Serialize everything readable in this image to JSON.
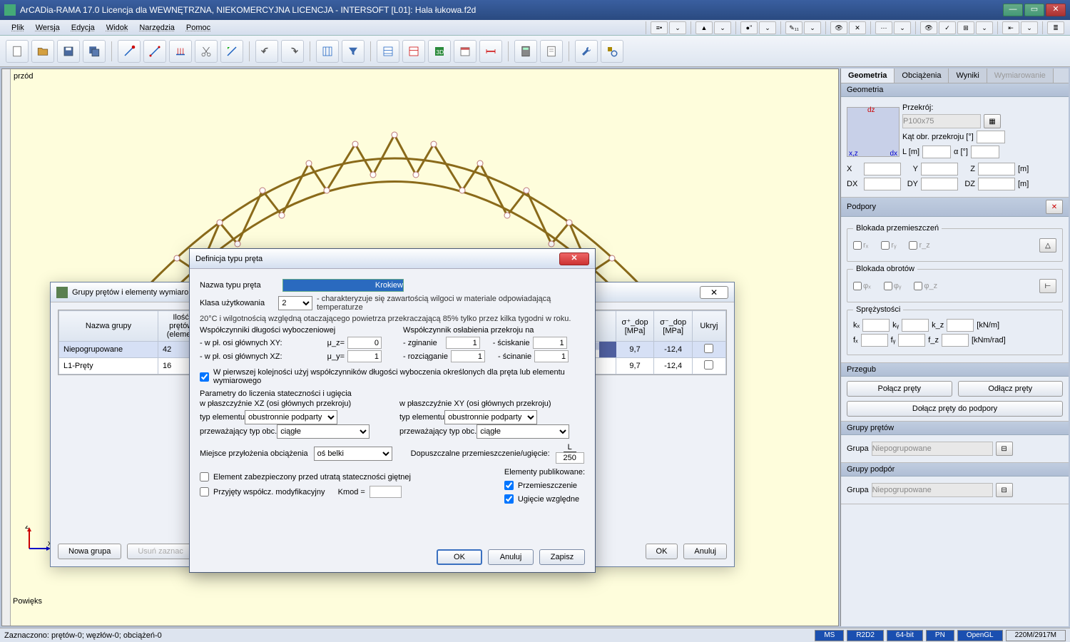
{
  "title": "ArCADia-RAMA 17.0 Licencja dla WEWNĘTRZNA, NIEKOMERCYJNA LICENCJA - INTERSOFT [L01]: Hala łukowa.f2d",
  "menu": [
    "Plik",
    "Wersja",
    "Edycja",
    "Widok",
    "Narzędzia",
    "Pomoc"
  ],
  "tiny_tools": [
    "≡•",
    "⌄",
    "▲",
    "⌄",
    "●\"",
    "⌄",
    "✎₁₁",
    "⌄",
    "👁",
    "✕",
    "⋯",
    "⌄",
    "👁",
    "✓",
    "⊞",
    "⌄",
    "⇤",
    "⌄",
    "≣"
  ],
  "view_label": "przód",
  "right_tabs": [
    "Geometria",
    "Obciążenia",
    "Wyniki",
    "Wymiarowanie"
  ],
  "geom": {
    "hdr": "Geometria",
    "przekroj_lbl": "Przekrój:",
    "cross_value": "P100x75",
    "kat_lbl": "Kąt obr. przekroju [°]",
    "L_lbl": "L [m]",
    "a_lbl": "α [°]",
    "X": "X",
    "Y": "Y",
    "Z": "Z",
    "m": "[m]",
    "DX": "DX",
    "DY": "DY",
    "DZ": "DZ",
    "axes": {
      "dz": "dz",
      "xz": "x,z",
      "dx": "dx"
    }
  },
  "podpory": {
    "hdr": "Podpory",
    "blok_prz": "Blokada przemieszczeń",
    "rx": "rₓ",
    "ry": "rᵧ",
    "rz": "r_z",
    "blok_obr": "Blokada obrotów",
    "fx": "φₓ",
    "fy": "φᵧ",
    "fz": "φ_z",
    "sprez": "Sprężystości",
    "kx": "kₓ",
    "ky": "kᵧ",
    "kz": "k_z",
    "knm": "[kN/m]",
    "fxl": "fₓ",
    "fyl": "fᵧ",
    "fzl": "f_z",
    "knmrad": "[kNm/rad]"
  },
  "przegub": {
    "hdr": "Przegub",
    "polacz": "Połącz pręty",
    "odlacz": "Odłącz pręty",
    "dolacz": "Dołącz pręty do podpory"
  },
  "grupy_pretow": {
    "hdr": "Grupy prętów",
    "lbl": "Grupa",
    "val": "Niepogrupowane"
  },
  "grupy_podpor": {
    "hdr": "Grupy podpór",
    "lbl": "Grupa",
    "val": "Niepogrupowane"
  },
  "groups_win": {
    "title": "Grupy prętów i elementy wymiaro",
    "cols": [
      "Nazwa\ngrupy",
      "Ilość\nprętów\n(elemen",
      "",
      "σ⁺_dop\n[MPa]",
      "σ⁻_dop\n[MPa]",
      "Ukryj"
    ],
    "rows": [
      {
        "name": "Niepogrupowane",
        "count": "42",
        "sp": "9,7",
        "sm": "-12,4",
        "hide": false
      },
      {
        "name": "L1-Pręty",
        "count": "16",
        "sp": "9,7",
        "sm": "-12,4",
        "hide": false
      }
    ],
    "btns": {
      "nowa": "Nowa grupa",
      "usun": "Usuń zaznac",
      "ok": "OK",
      "anuluj": "Anuluj"
    }
  },
  "def": {
    "title": "Definicja typu pręta",
    "nazwa_lbl": "Nazwa typu pręta",
    "nazwa_val": "Krokiew",
    "klasa_lbl": "Klasa użytkowania",
    "klasa_val": "2",
    "klasa_desc": "- charakteryzuje się zawartością wilgoci w materiale odpowiadającą temperaturze",
    "klasa_desc2": "20°C i wilgotnością względną otaczającego powietrza przekraczającą 85% tylko przez kilka tygodni w roku.",
    "wsp_dlug": "Współczynniki długości wyboczeniowej",
    "xy_lbl": "- w pł. osi głównych XY:",
    "mu_z": "μ_z=",
    "xy_val": "0",
    "xz_lbl": "- w pł. osi głównych XZ:",
    "mu_y": "μ_y=",
    "xz_val": "1",
    "wsp_osl": "Współczynnik osłabienia przekroju na",
    "zg": "- zginanie",
    "zg_v": "1",
    "sc": "- ściskanie",
    "sc_v": "1",
    "roz": "- rozciąganie",
    "roz_v": "1",
    "scin": "- ścinanie",
    "scin_v": "1",
    "pierw_kol": "W pierwszej kolejności użyj współczynników długości wyboczenia określonych dla pręta lub elementu wymiarowego",
    "param_hdr": "Parametry do liczenia stateczności i ugięcia",
    "pl_xz": "w płaszczyźnie XZ (osi głównych przekroju)",
    "pl_xy": "w płaszczyźnie XY (osi głównych przekroju)",
    "typ_el": "typ elementu",
    "typ_val": "obustronnie podparty",
    "przew": "przeważający typ obc.",
    "przew_val": "ciągłe",
    "miejsce": "Miejsce przyłożenia obciążenia",
    "miejsce_val": "oś belki",
    "dopu": "Dopuszczalne przemieszczenie/ugięcie:",
    "frac_top": "L",
    "frac_bot": "250",
    "elem_zab": "Element zabezpieczony przed utratą stateczności giętnej",
    "przyj": "Przyjęty współcz. modyfikacyjny",
    "kmod": "Kmod =",
    "elem_pub": "Elementy publikowane:",
    "przem": "Przemieszczenie",
    "ugie": "Ugięcie względne",
    "ok": "OK",
    "anuluj": "Anuluj",
    "zapisz": "Zapisz"
  },
  "zoom": "Powięks",
  "status": {
    "sel": "Zaznaczono: prętów-0; węzłów-0; obciążeń-0",
    "segs": [
      "MS",
      "R2D2",
      "64-bit",
      "PN",
      "OpenGL",
      "220M/2917M"
    ]
  }
}
